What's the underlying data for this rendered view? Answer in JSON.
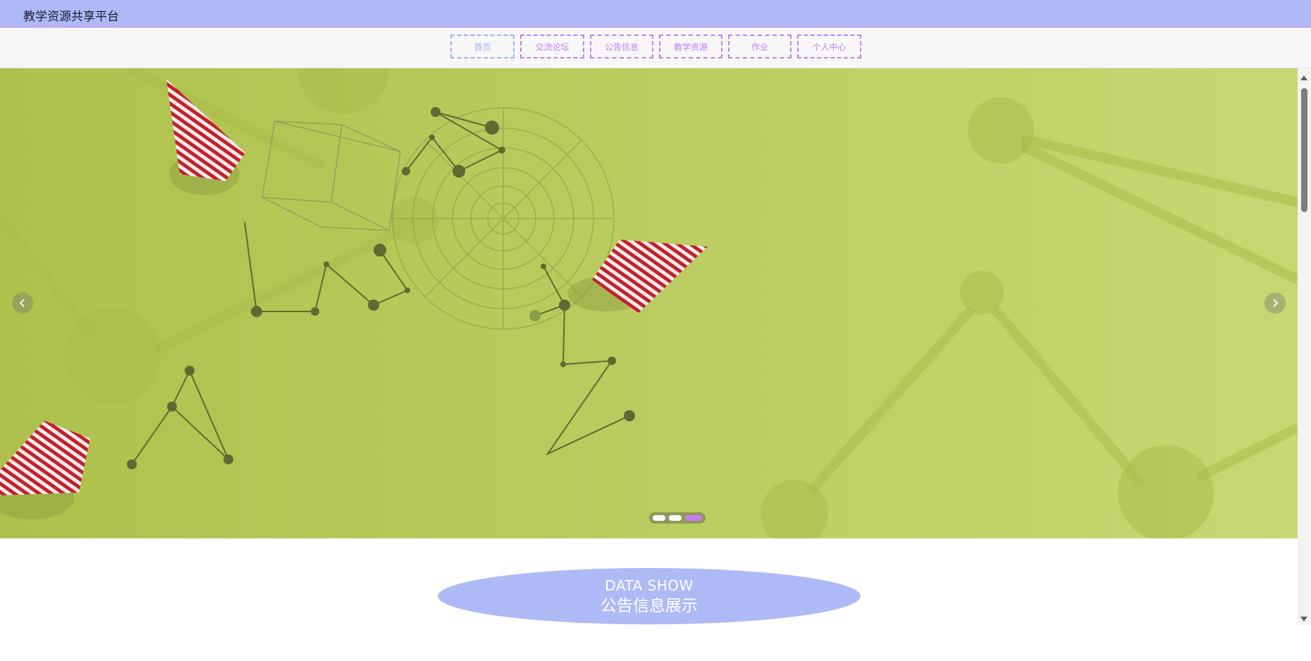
{
  "app": {
    "title": "教学资源共享平台"
  },
  "nav": {
    "items": [
      {
        "label": "首页",
        "active": true
      },
      {
        "label": "交流论坛",
        "active": false
      },
      {
        "label": "公告信息",
        "active": false
      },
      {
        "label": "教学资源",
        "active": false
      },
      {
        "label": "作业",
        "active": false
      },
      {
        "label": "个人中心",
        "active": false
      }
    ]
  },
  "carousel": {
    "slide_count": 3,
    "active_index": 2,
    "prev_icon": "chevron-left-icon",
    "next_icon": "chevron-right-icon"
  },
  "section": {
    "title_en": "DATA SHOW",
    "title_cn": "公告信息展示"
  },
  "colors": {
    "accent_purple": "#c77cf0",
    "accent_blue": "#aebaf5",
    "banner_green": "#b5c95a"
  }
}
